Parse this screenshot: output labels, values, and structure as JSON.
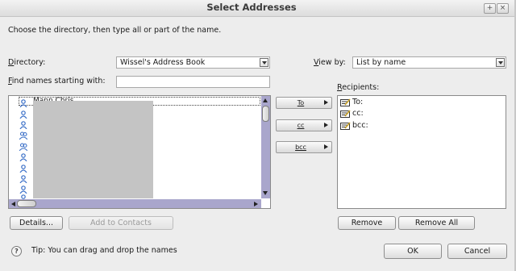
{
  "window": {
    "title": "Select Addresses"
  },
  "instructions": "Choose the directory, then type all or part of the name.",
  "directory": {
    "label": "Directory:",
    "value": "Wissel's Address Book"
  },
  "find": {
    "label": "Find names starting with:",
    "value": ""
  },
  "view_by": {
    "label": "View by:",
    "value": "List by name"
  },
  "address_list": {
    "first_row": "Mann Chris"
  },
  "move_buttons": {
    "to": "To",
    "cc": "cc",
    "bcc": "bcc"
  },
  "recipients": {
    "label": "Recipients:",
    "items": [
      "To:",
      "cc:",
      "bcc:"
    ]
  },
  "buttons": {
    "details": "Details...",
    "add_to_contacts": "Add to Contacts",
    "remove": "Remove",
    "remove_all": "Remove All",
    "ok": "OK",
    "cancel": "Cancel"
  },
  "tip": "Tip: You can drag and drop the names",
  "icons": {
    "person": "person-icon",
    "group": "group-icon",
    "recipient": "recipient-card-icon",
    "help": "help-icon"
  },
  "colors": {
    "scrollbar_track": "#a9a6cc",
    "person_icon": "#3a6fc8",
    "redaction": "#c4c4c4"
  }
}
